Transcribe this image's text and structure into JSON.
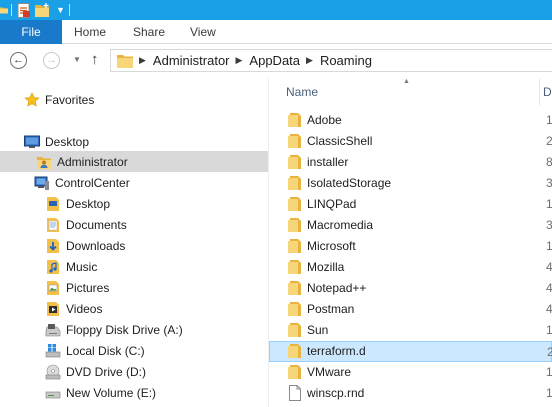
{
  "colors": {
    "titlebar": "#19a0e6",
    "file_tab": "#1979ca",
    "folder_yellow": "#f2c04b",
    "selection_blue": "#cce8ff",
    "nav_selected": "#d9d9d9"
  },
  "ribbon": {
    "file": "File",
    "home": "Home",
    "share": "Share",
    "view": "View"
  },
  "address": {
    "crumbs": [
      "Administrator",
      "AppData",
      "Roaming"
    ]
  },
  "nav": {
    "favorites": "Favorites",
    "desktop": "Desktop",
    "administrator": "Administrator",
    "computer": "ControlCenter",
    "items": [
      "Desktop",
      "Documents",
      "Downloads",
      "Music",
      "Pictures",
      "Videos",
      "Floppy Disk Drive (A:)",
      "Local Disk (C:)",
      "DVD Drive (D:)",
      "New Volume (E:)"
    ]
  },
  "columns": {
    "name": "Name",
    "next_initial": "D"
  },
  "files": [
    {
      "name": "Adobe",
      "date_initial": "1"
    },
    {
      "name": "ClassicShell",
      "date_initial": "2"
    },
    {
      "name": "installer",
      "date_initial": "8"
    },
    {
      "name": "IsolatedStorage",
      "date_initial": "3"
    },
    {
      "name": "LINQPad",
      "date_initial": "1"
    },
    {
      "name": "Macromedia",
      "date_initial": "3"
    },
    {
      "name": "Microsoft",
      "date_initial": "1"
    },
    {
      "name": "Mozilla",
      "date_initial": "4"
    },
    {
      "name": "Notepad++",
      "date_initial": "4"
    },
    {
      "name": "Postman",
      "date_initial": "4"
    },
    {
      "name": "Sun",
      "date_initial": "1"
    },
    {
      "name": "terraform.d",
      "date_initial": "2"
    },
    {
      "name": "VMware",
      "date_initial": "1"
    },
    {
      "name": "winscp.rnd",
      "date_initial": "1"
    }
  ]
}
